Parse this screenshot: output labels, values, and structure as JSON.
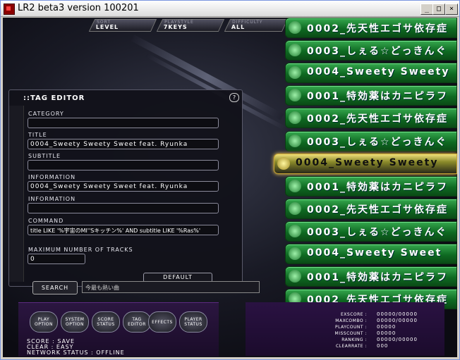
{
  "window": {
    "title": "LR2 beta3 version 100201",
    "minimize": "_",
    "maximize": "□",
    "close": "×"
  },
  "header": {
    "tabs": [
      {
        "caption": "SORT",
        "value": "LEVEL"
      },
      {
        "caption": "PLAYSTYLE",
        "value": "7KEYS"
      },
      {
        "caption": "DIFFICULTY",
        "value": "ALL"
      }
    ]
  },
  "songs": [
    "0002_先天性エゴサ依存症",
    "0003_しぇる☆どっきんぐ",
    "0004_Sweety Sweety",
    "0001_特効薬はカニピラフ",
    "0002_先天性エゴサ依存症",
    "0003_しぇる☆どっきんぐ",
    "0004_Sweety Sweety",
    "0001_特効薬はカニピラフ",
    "0002_先天性エゴサ依存症",
    "0003_しぇる☆どっきんぐ",
    "0004_Sweety Sweet",
    "0001_特効薬はカニピラフ",
    "0002_先天性エゴサ依存症"
  ],
  "selected_index": 6,
  "editor": {
    "title": "::TAG EDITOR",
    "help": "?",
    "fields": [
      {
        "label": "CATEGORY",
        "value": ""
      },
      {
        "label": "TITLE",
        "value": "0004_Sweety Sweety Sweet feat. Ryunka"
      },
      {
        "label": "SUBTITLE",
        "value": ""
      },
      {
        "label": "INFORMATION",
        "value": "0004_Sweety Sweety Sweet feat. Ryunka"
      },
      {
        "label": "INFORMATION",
        "value": ""
      },
      {
        "label": "COMMAND",
        "value": "title LIKE '%宇宙のMI''Sキッチン%' AND subtitle LIKE '%Ras%'"
      },
      {
        "label": "MAXIMUM NUMBER OF TRACKS",
        "value": "0"
      }
    ],
    "default_label": "DEFAULT"
  },
  "search": {
    "button": "SEARCH",
    "value": "今最も熱い曲"
  },
  "menu": [
    {
      "line1": "PLAY",
      "line2": "OPTION"
    },
    {
      "line1": "SYSTEM",
      "line2": "OPTION"
    },
    {
      "line1": "SCORE",
      "line2": "STATUS"
    },
    {
      "line1": "TAG",
      "line2": "EDITOR"
    },
    {
      "line1": "EFFECTS",
      "line2": ""
    },
    {
      "line1": "PLAYER",
      "line2": "STATUS"
    }
  ],
  "status": {
    "score": "SCORE : SAVE",
    "clear": "CLEAR : EASY",
    "network": "NETWORK STATUS : OFFLINE"
  },
  "stats": [
    {
      "label": "EXSCORE :",
      "value": "00000/00000"
    },
    {
      "label": "MAXCOMBO :",
      "value": "00000/00000"
    },
    {
      "label": "PLAYCOUNT :",
      "value": "00000"
    },
    {
      "label": "MISSCOUNT :",
      "value": "00000"
    },
    {
      "label": "RANKING :",
      "value": "00000/00000"
    },
    {
      "label": "CLEARRATE :",
      "value": "000"
    }
  ]
}
